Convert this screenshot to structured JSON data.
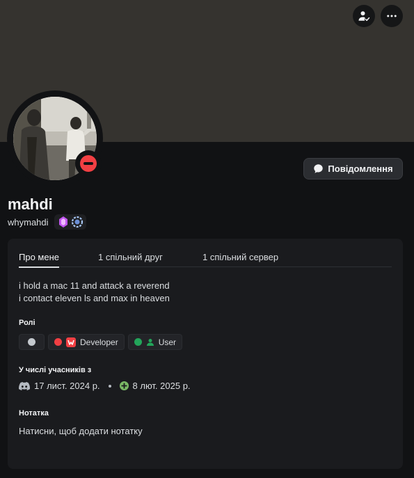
{
  "banner": {
    "add_friend_icon": "add-friend-icon",
    "more_icon": "more-icon"
  },
  "profile": {
    "display_name": "mahdi",
    "username": "whymahdi",
    "status": "do-not-disturb",
    "badges": [
      "nitro-gem-icon",
      "server-boost-icon"
    ]
  },
  "message_button": {
    "label": "Повідомлення",
    "icon": "chat-bubble-icon"
  },
  "tabs": [
    {
      "label": "Про мене",
      "active": true
    },
    {
      "label": "1 спільний друг",
      "active": false
    },
    {
      "label": "1 спільний сервер",
      "active": false
    }
  ],
  "bio": {
    "line1": "i hold a mac 11 and attack a reverend",
    "line2": "i contact eleven ls and max in heaven"
  },
  "roles": {
    "title": "Ролі",
    "items": [
      {
        "name": "",
        "color": "#c4c9ce"
      },
      {
        "name": "Developer",
        "color": "#f23f43",
        "icon": "developer-role-icon"
      },
      {
        "name": "User",
        "color": "#23a55a",
        "icon": "user-role-icon"
      }
    ]
  },
  "member_since": {
    "title": "У числі учасників з",
    "discord_date": "17 лист. 2024 р.",
    "server_date": "8 лют. 2025 р.",
    "discord_icon": "discord-logo-icon",
    "server_icon": "server-join-icon"
  },
  "note": {
    "title": "Нотатка",
    "placeholder": "Натисни, щоб додати нотатку"
  },
  "colors": {
    "background": "#111214",
    "banner": "#35332f",
    "panel": "#1a1b1e",
    "dnd": "#f23f43"
  }
}
